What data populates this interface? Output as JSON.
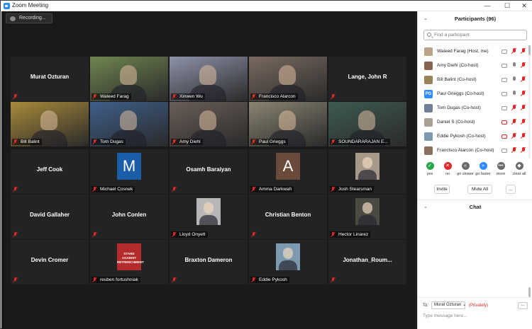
{
  "window": {
    "title": "Zoom Meeting"
  },
  "recording_label": "Recording...",
  "tiles": [
    {
      "kind": "name",
      "name": "Murat Ozturan",
      "muted": true
    },
    {
      "kind": "photo",
      "label": "Waleed Farag",
      "muted": true,
      "bg": "#6f8550"
    },
    {
      "kind": "photo",
      "label": "Xinwen Wu",
      "muted": true,
      "bg": "#8d92a8"
    },
    {
      "kind": "photo",
      "label": "Francisco Alarcon",
      "muted": true,
      "bg": "#7a6a60"
    },
    {
      "kind": "name",
      "name": "Lange, John R",
      "muted": true
    },
    {
      "kind": "photo",
      "label": "Bill Balint",
      "muted": true,
      "bg": "#a88a3a",
      "active": true
    },
    {
      "kind": "photo",
      "label": "Tom Dugas",
      "muted": true,
      "bg": "#3f5f8a"
    },
    {
      "kind": "photo",
      "label": "Amy Diehl",
      "muted": true,
      "bg": "#6a5e58"
    },
    {
      "kind": "photo",
      "label": "Paul Grieggs",
      "muted": true,
      "bg": "#8a8472"
    },
    {
      "kind": "photo",
      "label": "SOUNDARARAJAN E...",
      "muted": true,
      "bg": "#3e5a52"
    },
    {
      "kind": "name",
      "name": "Jeff Cook",
      "muted": true
    },
    {
      "kind": "avatar",
      "letter": "M",
      "label": "Michael Cosnek",
      "muted": true,
      "bg": "#1b5ea8"
    },
    {
      "kind": "name",
      "name": "Osamh Baraiyan",
      "muted": true
    },
    {
      "kind": "avatar",
      "letter": "A",
      "label": "Amma Darkwah",
      "muted": true,
      "bg": "#6b4a3c"
    },
    {
      "kind": "avatar",
      "letter": "",
      "label": "Josh Stearsman",
      "muted": true,
      "bg": "#a7998a"
    },
    {
      "kind": "name",
      "name": "David Gallaher",
      "muted": true
    },
    {
      "kind": "name",
      "name": "John Conlen",
      "muted": true
    },
    {
      "kind": "avatar",
      "letter": "",
      "label": "Lloyd Onyett",
      "muted": true,
      "bg": "#b8b6b8"
    },
    {
      "kind": "name",
      "name": "Christian Benton",
      "muted": true
    },
    {
      "kind": "avatar",
      "letter": "",
      "label": "Hector Linarez",
      "muted": true,
      "bg": "#4a4a42"
    },
    {
      "kind": "name",
      "name": "Devin Cromer",
      "muted": true
    },
    {
      "kind": "avatar",
      "letter": "",
      "label": "reuben fortushniak",
      "muted": true,
      "bg": "#b52a2a",
      "poster": [
        "STAND AGAINST",
        "RETRENCHMENT"
      ]
    },
    {
      "kind": "name",
      "name": "Braxton Dameron",
      "muted": true
    },
    {
      "kind": "avatar",
      "letter": "",
      "label": "Eddie Pykosh",
      "muted": true,
      "bg": "#7b9ab0"
    },
    {
      "kind": "name",
      "name": "Jonathan_Roum...",
      "muted": true
    }
  ],
  "participants_panel": {
    "title": "Participants (96)",
    "search_placeholder": "Find a participant",
    "items": [
      {
        "name": "Waleed Farag (Host, me)",
        "initials": "",
        "color": "#bda38a",
        "mic_off": true,
        "video_off": false
      },
      {
        "name": "Amy Diehl (Co-host)",
        "initials": "",
        "color": "#8a6452",
        "mic_off": false,
        "video_off": false
      },
      {
        "name": "Bill Balint (Co-host)",
        "initials": "",
        "color": "#9a8358",
        "mic_off": false,
        "video_off": false
      },
      {
        "name": "Paul Grieggs (Co-host)",
        "initials": "PG",
        "color": "#2d8cff",
        "mic_off": false,
        "video_off": false
      },
      {
        "name": "Tom Dugas (Co-host)",
        "initials": "",
        "color": "#6f7f98",
        "mic_off": true,
        "video_off": false
      },
      {
        "name": "Daniel S (Co-host)",
        "initials": "",
        "color": "#a8a092",
        "mic_off": true,
        "video_off": true
      },
      {
        "name": "Eddie Pykosh (Co-host)",
        "initials": "",
        "color": "#7b9ab0",
        "mic_off": true,
        "video_off": true
      },
      {
        "name": "Francisco Alarcón (Co-host)",
        "initials": "",
        "color": "#8a705e",
        "mic_off": true,
        "video_off": false
      }
    ],
    "reactions": [
      {
        "label": "yes",
        "symbol": "✓",
        "color": "#26a84a"
      },
      {
        "label": "no",
        "symbol": "✕",
        "color": "#e02828"
      },
      {
        "label": "go slower",
        "symbol": "«",
        "color": "#6a6a6a"
      },
      {
        "label": "go faster",
        "symbol": "»",
        "color": "#2d8cff"
      },
      {
        "label": "more",
        "symbol": "•••",
        "color": "#6a6a6a"
      },
      {
        "label": "clear all",
        "symbol": "◆",
        "color": "#6a6a6a"
      }
    ],
    "buttons": {
      "invite": "Invite",
      "mute_all": "Mute All",
      "more": "..."
    }
  },
  "chat_panel": {
    "title": "Chat",
    "to_label": "To:",
    "recipient": "Murat Ozturan",
    "privacy": "(Privately)",
    "more": "...",
    "input_placeholder": "Type message here..."
  }
}
